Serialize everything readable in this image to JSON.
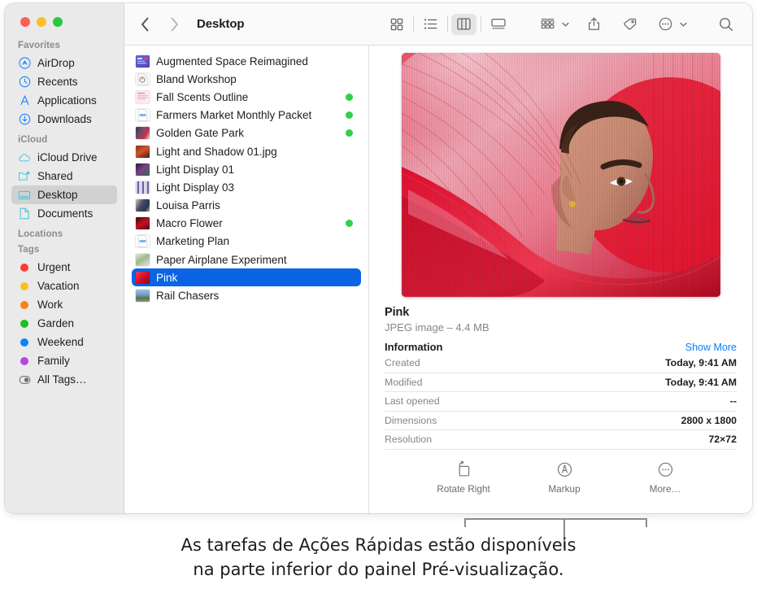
{
  "window": {
    "traffic_lights": [
      {
        "name": "close",
        "color": "#ff5f57"
      },
      {
        "name": "minimize",
        "color": "#febc2e"
      },
      {
        "name": "maximize",
        "color": "#28c840"
      }
    ]
  },
  "sidebar": {
    "sections": [
      {
        "header": "Favorites",
        "items": [
          {
            "label": "AirDrop",
            "icon": "airdrop-icon"
          },
          {
            "label": "Recents",
            "icon": "clock-icon"
          },
          {
            "label": "Applications",
            "icon": "applications-icon"
          },
          {
            "label": "Downloads",
            "icon": "downloads-icon"
          }
        ]
      },
      {
        "header": "iCloud",
        "items": [
          {
            "label": "iCloud Drive",
            "icon": "cloud-icon"
          },
          {
            "label": "Shared",
            "icon": "shared-folder-icon"
          },
          {
            "label": "Desktop",
            "icon": "desktop-icon",
            "selected": true
          },
          {
            "label": "Documents",
            "icon": "document-icon"
          }
        ]
      },
      {
        "header": "Locations",
        "items": []
      },
      {
        "header": "Tags",
        "items": [
          {
            "label": "Urgent",
            "icon": "tag-dot-icon",
            "color": "#fc3b35"
          },
          {
            "label": "Vacation",
            "icon": "tag-dot-icon",
            "color": "#fcc01e"
          },
          {
            "label": "Work",
            "icon": "tag-dot-icon",
            "color": "#fa8019"
          },
          {
            "label": "Garden",
            "icon": "tag-dot-icon",
            "color": "#18c218"
          },
          {
            "label": "Weekend",
            "icon": "tag-dot-icon",
            "color": "#0a84ff"
          },
          {
            "label": "Family",
            "icon": "tag-dot-icon",
            "color": "#b546e0"
          },
          {
            "label": "All Tags…",
            "icon": "all-tags-icon"
          }
        ]
      }
    ]
  },
  "toolbar": {
    "back_icon": "chevron-left-icon",
    "forward_icon": "chevron-right-icon",
    "title": "Desktop",
    "view_icon_grid": "icon-view-icon",
    "view_list": "list-view-icon",
    "view_column": "column-view-icon",
    "view_gallery": "gallery-view-icon",
    "group_icon": "group-by-icon",
    "share_icon": "share-icon",
    "tags_icon": "tag-icon",
    "more_icon": "more-actions-icon",
    "search_icon": "search-icon"
  },
  "files": [
    {
      "name": "Augmented Space Reimagined",
      "icon": "presentation-thumb",
      "tag": null
    },
    {
      "name": "Bland Workshop",
      "icon": "doc-thumb",
      "tag": null
    },
    {
      "name": "Fall Scents Outline",
      "icon": "pages-thumb",
      "tag": null,
      "tag_color": "#2fd04a"
    },
    {
      "name": "Farmers Market Monthly Packet",
      "icon": "pdf-thumb",
      "tag": "green",
      "tag_color": "#2fd04a"
    },
    {
      "name": "Golden Gate Park",
      "icon": "photo-thumb",
      "tag": "green",
      "tag_color": "#2fd04a"
    },
    {
      "name": "Light and Shadow 01.jpg",
      "icon": "photo-thumb",
      "tag": null
    },
    {
      "name": "Light Display 01",
      "icon": "photo-thumb",
      "tag": null
    },
    {
      "name": "Light Display 03",
      "icon": "photo-thumb",
      "tag": null
    },
    {
      "name": "Louisa Parris",
      "icon": "photo-thumb",
      "tag": null
    },
    {
      "name": "Macro Flower",
      "icon": "photo-thumb",
      "tag": "green",
      "tag_color": "#2fd04a"
    },
    {
      "name": "Marketing Plan",
      "icon": "pdf-thumb",
      "tag": null
    },
    {
      "name": "Paper Airplane Experiment",
      "icon": "photo-thumb",
      "tag": null
    },
    {
      "name": "Pink",
      "icon": "photo-thumb",
      "tag": null,
      "selected": true
    },
    {
      "name": "Rail Chasers",
      "icon": "photo-thumb",
      "tag": null
    }
  ],
  "files_tag_fix": {
    "fall_scents_has_tag": true
  },
  "preview": {
    "title": "Pink",
    "subtitle": "JPEG image – 4.4 MB",
    "section_title": "Information",
    "show_more": "Show More",
    "info": [
      {
        "key": "Created",
        "value": "Today, 9:41 AM"
      },
      {
        "key": "Modified",
        "value": "Today, 9:41 AM"
      },
      {
        "key": "Last opened",
        "value": "--"
      },
      {
        "key": "Dimensions",
        "value": "2800 x 1800"
      },
      {
        "key": "Resolution",
        "value": "72×72"
      }
    ],
    "quick_actions": [
      {
        "label": "Rotate Right",
        "icon": "rotate-right-icon"
      },
      {
        "label": "Markup",
        "icon": "markup-icon"
      },
      {
        "label": "More…",
        "icon": "more-ellipsis-icon"
      }
    ]
  },
  "caption": {
    "line1": "As tarefas de Ações Rápidas estão disponíveis",
    "line2": "na parte inferior do painel Pré-visualização."
  },
  "colors": {
    "selection_blue": "#0a64e4",
    "link_blue": "#0a7cff",
    "sidebar_bg": "#ebeaea",
    "tag_green": "#2fd04a"
  }
}
